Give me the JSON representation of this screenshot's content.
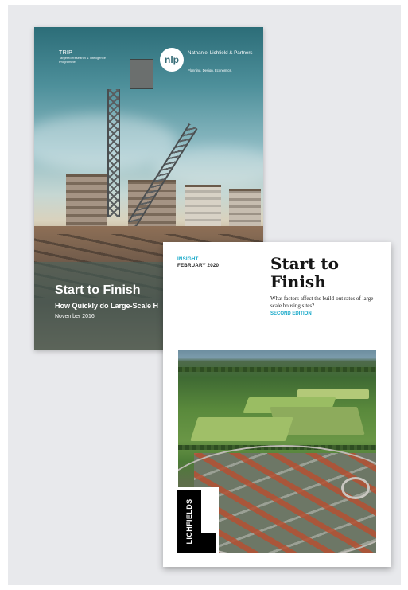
{
  "back_cover": {
    "trip_title": "TRIP",
    "trip_subtitle": "Targeted Research & Intelligence Programme",
    "logo_mark": "nlp",
    "publisher": "Nathaniel Lichfield & Partners",
    "publisher_tagline": "Planning. Design. Economics.",
    "title": "Start to Finish",
    "subtitle": "How Quickly do Large-Scale H",
    "date": "November 2016"
  },
  "front_cover": {
    "series": "INSIGHT",
    "date": "FEBRUARY 2020",
    "title": "Start to Finish",
    "subtitle": "What factors affect the build-out rates of large scale housing sites?",
    "edition": "SECOND EDITION",
    "brand": "LICHFIELDS"
  },
  "colors": {
    "accent": "#16a8c8",
    "panel_bg": "#e8e9ec",
    "brand_black": "#000000"
  }
}
